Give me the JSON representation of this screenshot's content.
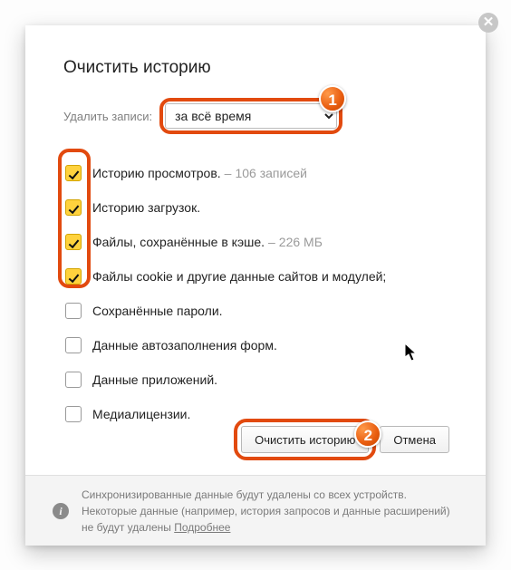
{
  "title": "Очистить историю",
  "range": {
    "label": "Удалить записи:",
    "selected": "за всё время"
  },
  "options": [
    {
      "label": "Историю просмотров.",
      "extra": "106 записей",
      "checked": true
    },
    {
      "label": "Историю загрузок.",
      "extra": "",
      "checked": true
    },
    {
      "label": "Файлы, сохранённые в кэше.",
      "extra": "226 МБ",
      "checked": true
    },
    {
      "label": "Файлы cookie и другие данные сайтов и модулей;",
      "extra": "",
      "checked": true
    },
    {
      "label": "Сохранённые пароли.",
      "extra": "",
      "checked": false
    },
    {
      "label": "Данные автозаполнения форм.",
      "extra": "",
      "checked": false
    },
    {
      "label": "Данные приложений.",
      "extra": "",
      "checked": false
    },
    {
      "label": "Медиалицензии.",
      "extra": "",
      "checked": false
    }
  ],
  "buttons": {
    "primary": "Очистить историю",
    "cancel": "Отмена"
  },
  "footer": {
    "text": "Синхронизированные данные будут удалены со всех устройств. Некоторые данные (например, история запросов и данные расширений) не будут удалены ",
    "link": "Подробнее"
  },
  "annotations": {
    "one": "1",
    "two": "2"
  }
}
